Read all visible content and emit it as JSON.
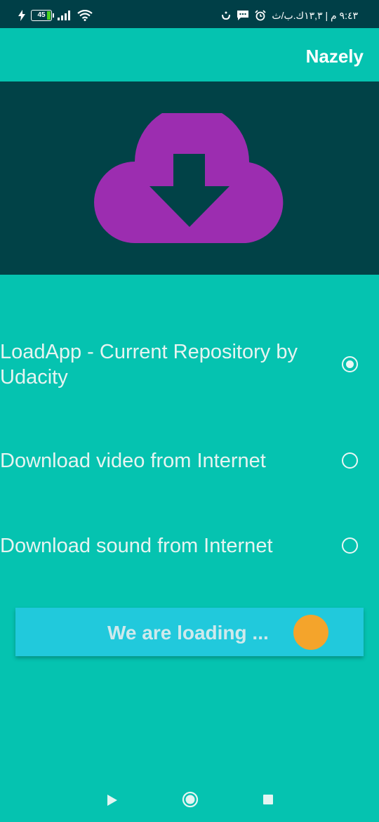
{
  "status_bar": {
    "battery": "45",
    "time_text": "٩:٤٣ م | ١٣,٣ك.ب/ث"
  },
  "app_bar": {
    "title": "Nazely"
  },
  "header_image": {
    "icon": "cloud-download-icon",
    "background": "#014247",
    "cloud_color": "#9c2db0"
  },
  "options": [
    {
      "label": "LoadApp - Current Repository by Udacity",
      "selected": true
    },
    {
      "label": "Download video from Internet",
      "selected": false
    },
    {
      "label": "Download sound from Internet",
      "selected": false
    }
  ],
  "load_button": {
    "label": "We are loading ...",
    "indicator_color": "#f4a42b"
  },
  "nav_bar": {
    "icons": [
      "back-icon",
      "home-icon",
      "recents-icon"
    ]
  },
  "colors": {
    "primary": "#05c3b0",
    "dark": "#014247",
    "button": "#21c9dc"
  }
}
